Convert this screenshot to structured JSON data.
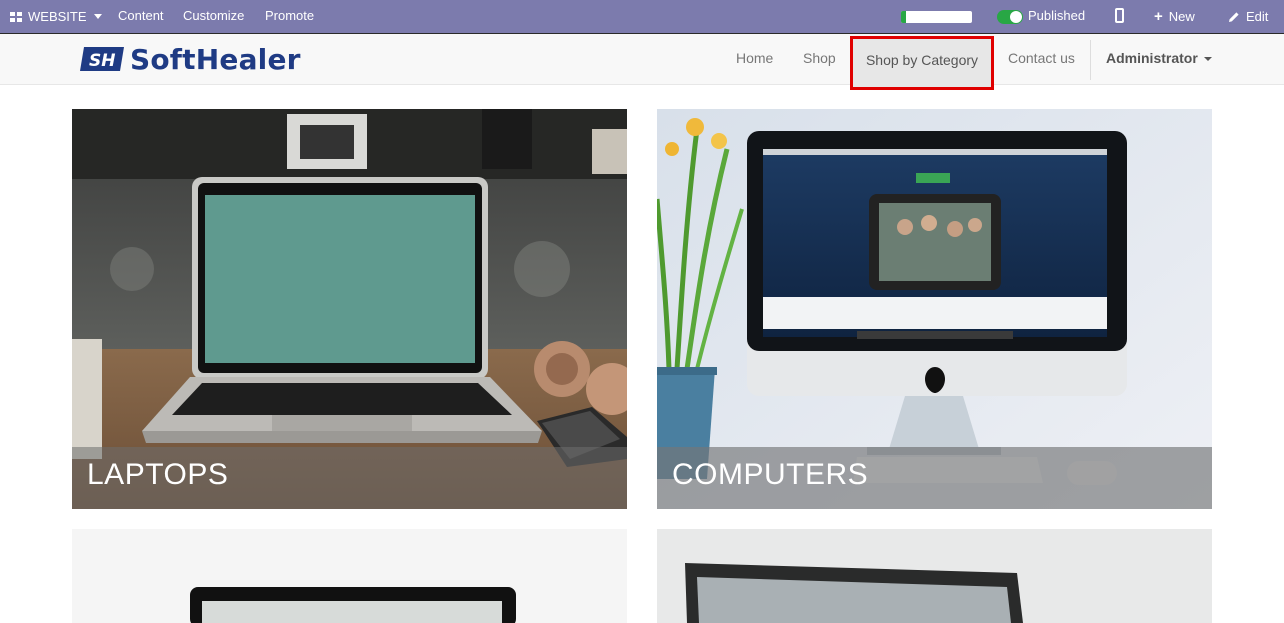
{
  "adminbar": {
    "website_label": "WEBSITE",
    "content_label": "Content",
    "customize_label": "Customize",
    "promote_label": "Promote",
    "progress": 0.07,
    "published_label": "Published",
    "new_label": "New",
    "edit_label": "Edit",
    "bar_color": "#7c7bad"
  },
  "navbar": {
    "logo_text": "SoftHealer",
    "links": {
      "home": "Home",
      "shop": "Shop",
      "shop_by_category": "Shop by Category",
      "contact": "Contact us"
    },
    "user": "Administrator",
    "highlight_color": "#e00000"
  },
  "categories": [
    {
      "label": "LAPTOPS",
      "icon": "laptop-image"
    },
    {
      "label": "COMPUTERS",
      "icon": "imac-image"
    },
    {
      "label": "",
      "icon": "monitor-image"
    },
    {
      "label": "",
      "icon": "laptop-screen-image"
    }
  ]
}
